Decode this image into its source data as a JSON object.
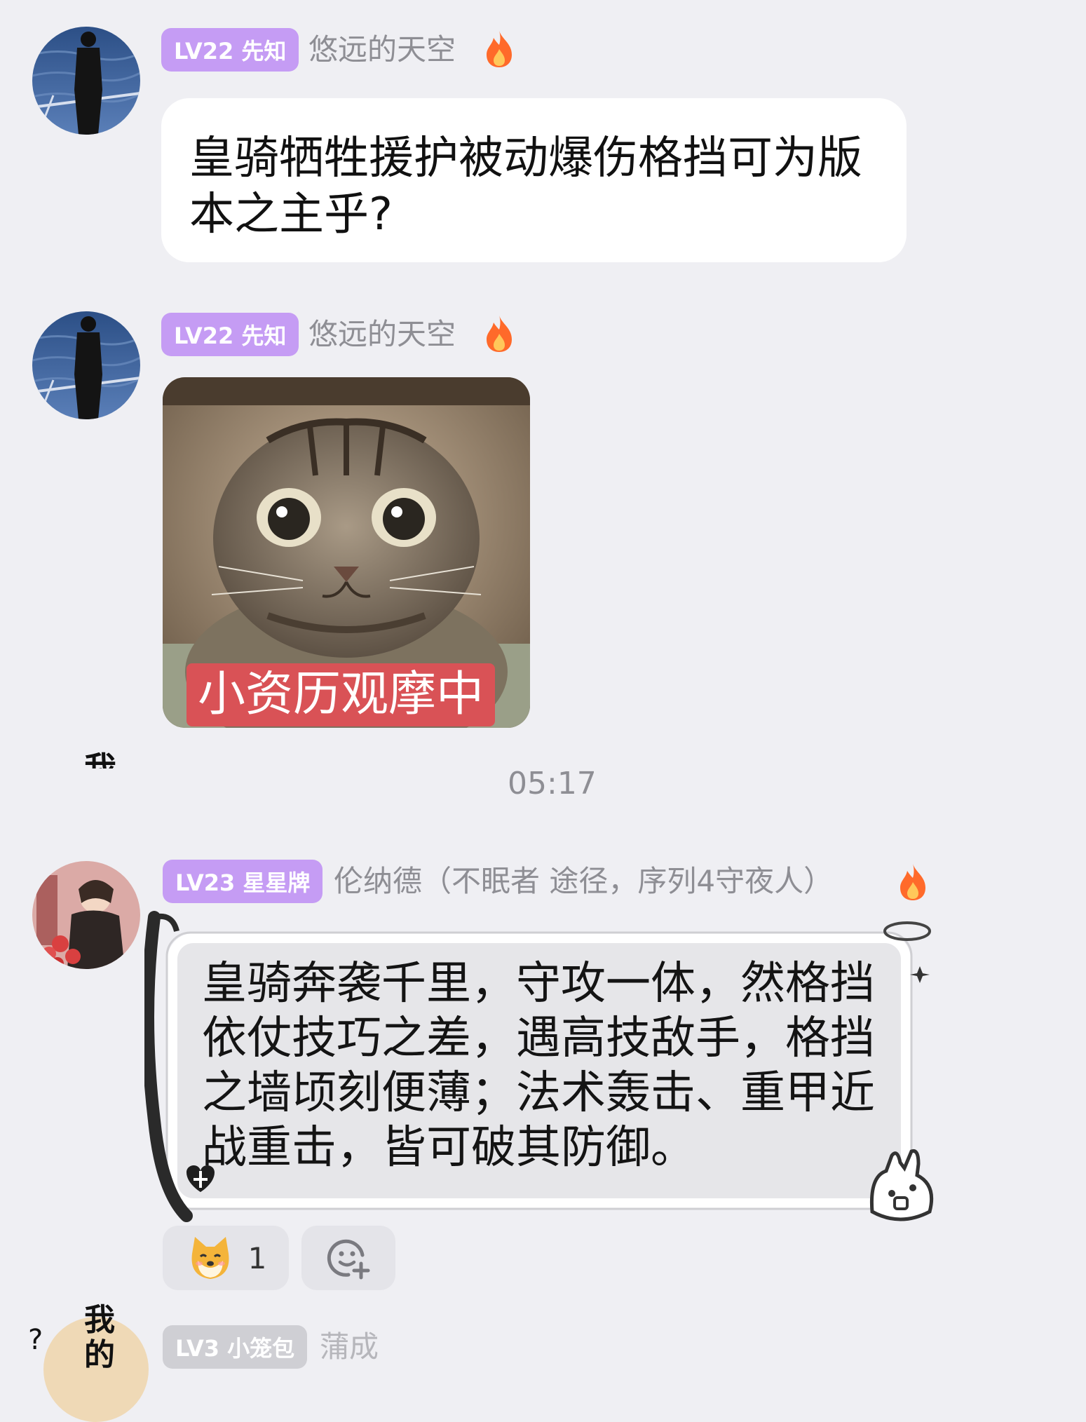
{
  "colors": {
    "background": "#efeff3",
    "level_badge": "#c59cf4",
    "level_badge_gray": "#cfcfd4",
    "username": "#8e8e94",
    "caption_bg": "#d95256"
  },
  "messages": [
    {
      "level_badge": "LV22 先知",
      "username": "悠远的天空",
      "text": "皇骑牺牲援护被动爆伤格挡可为版本之主乎?"
    },
    {
      "level_badge": "LV22 先知",
      "username": "悠远的天空",
      "image_caption": "小资历观摩中"
    },
    {
      "level_badge": "LV23 星星牌",
      "username": "伦纳德（不眠者 途径，序列4守夜人）",
      "text": "皇骑奔袭千里，守攻一体，然格挡依仗技巧之差，遇高技敌手，格挡之墙顷刻便薄；法术轰击、重甲近战重击，皆可破其防御。",
      "reactions": [
        {
          "icon": "shiba-emoji-icon",
          "count": "1"
        }
      ]
    },
    {
      "level_badge": "LV3 小笼包",
      "username": "蒲成"
    }
  ],
  "timestamp": "05:17",
  "partial_glyphs": {
    "top": "我",
    "bottom": "我 的",
    "left": "?"
  }
}
